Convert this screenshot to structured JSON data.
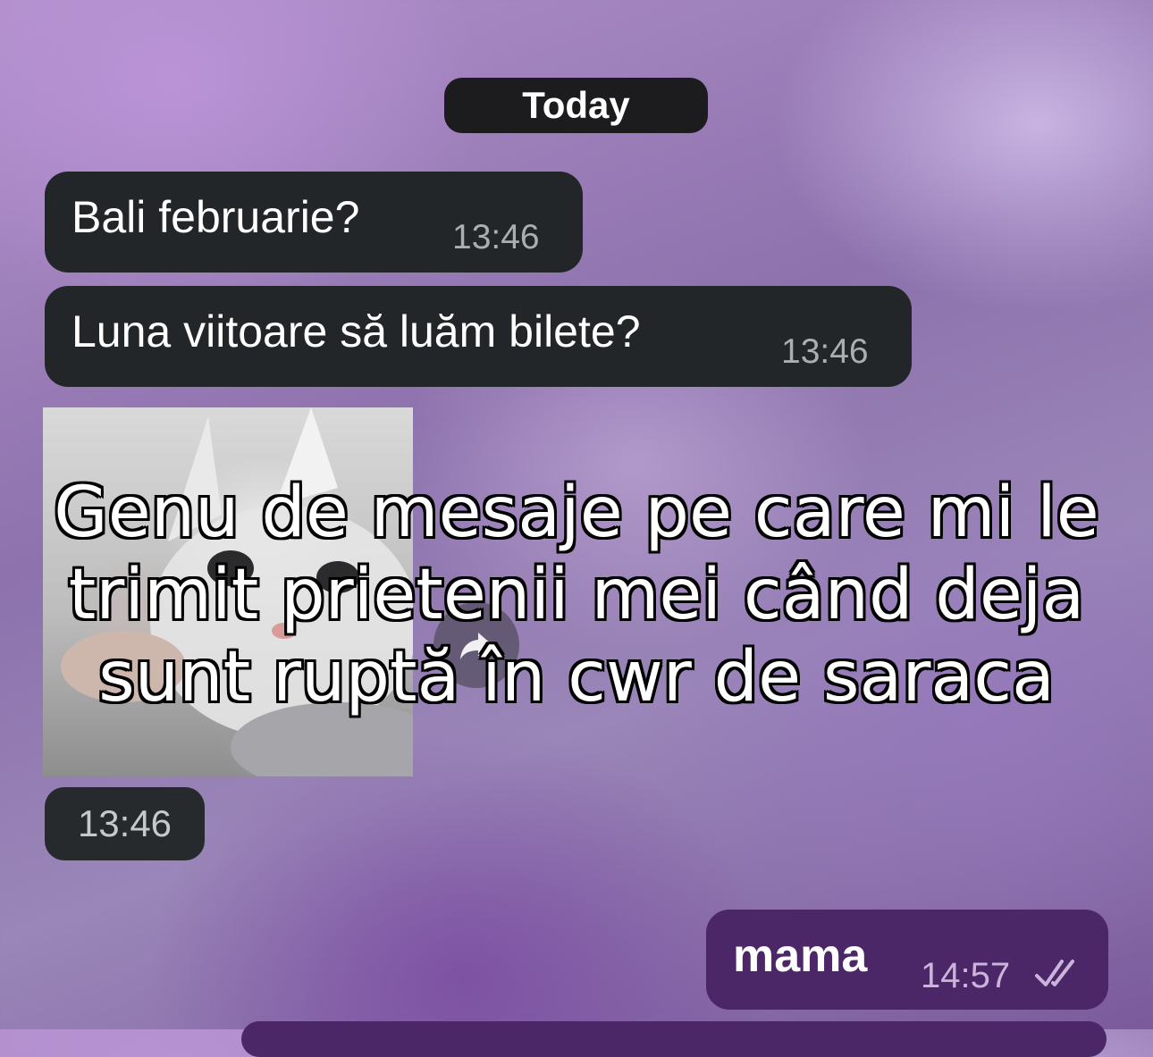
{
  "date_separator": "Today",
  "messages": [
    {
      "direction": "incoming",
      "text": "Bali februarie?",
      "time": "13:46"
    },
    {
      "direction": "incoming",
      "text": "Luna viitoare să luăm bilete?",
      "time": "13:46"
    },
    {
      "direction": "incoming",
      "type": "video",
      "time": "13:46"
    },
    {
      "direction": "outgoing",
      "text": "mama",
      "time": "14:57",
      "status": "read"
    }
  ],
  "overlay_caption": [
    "Genu de mesaje pe care mi le",
    "trimit prietenii mei când deja",
    "sunt ruptă în cwr de saraca"
  ],
  "colors": {
    "incoming_bubble": "#232628",
    "outgoing_bubble": "#4c2768",
    "date_pill": "#1c1c1e"
  },
  "icons": {
    "forward": "forward-share-icon",
    "read_status": "double-check-icon"
  }
}
